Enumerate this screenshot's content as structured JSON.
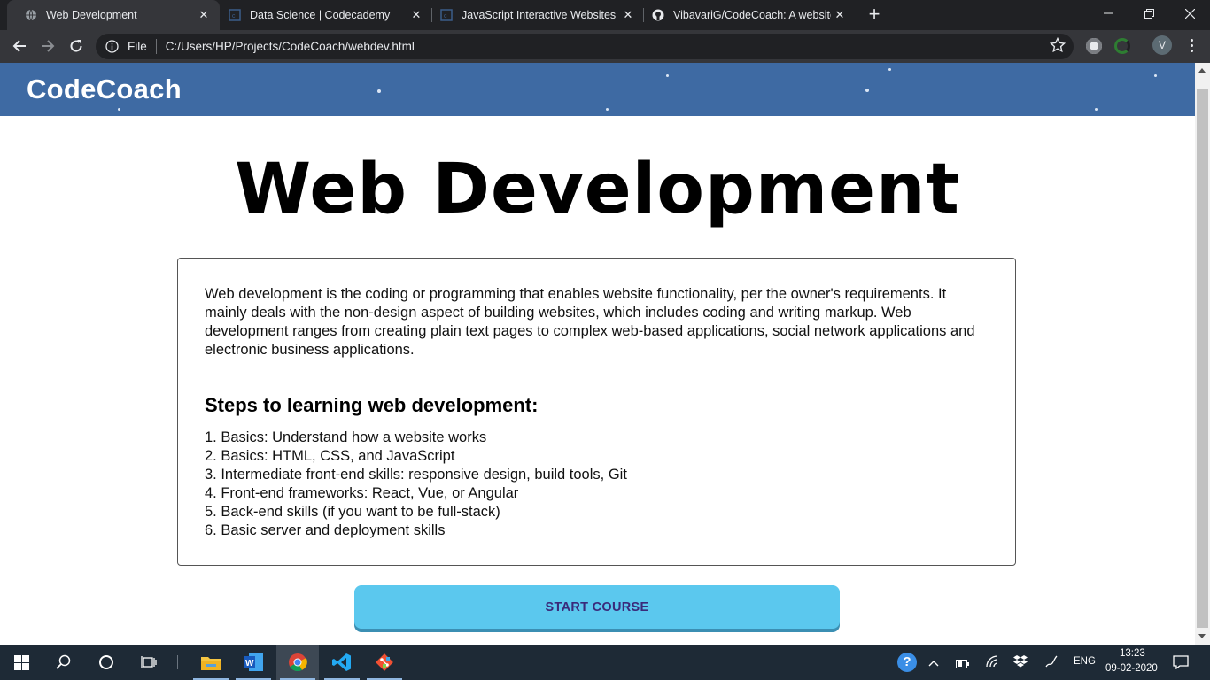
{
  "browser": {
    "tabs": [
      {
        "label": "Web Development",
        "icon": "globe-icon",
        "active": true
      },
      {
        "label": "Data Science | Codecademy",
        "icon": "codecademy-icon",
        "active": false
      },
      {
        "label": "JavaScript Interactive Websites | C",
        "icon": "codecademy-icon",
        "active": false
      },
      {
        "label": "VibavariG/CodeCoach: A website",
        "icon": "github-icon",
        "active": false
      }
    ],
    "new_tab": "+",
    "address": {
      "scheme_label": "File",
      "url": "C:/Users/HP/Projects/CodeCoach/webdev.html"
    },
    "profile_initial": "V"
  },
  "site": {
    "brand": "CodeCoach",
    "title": "Web Development",
    "intro": "Web development is the coding or programming that enables website functionality, per the owner's requirements. It mainly deals with the non-design aspect of building websites, which includes coding and writing markup. Web development ranges from creating plain text pages to complex web-based applications, social network applications and electronic business applications.",
    "steps_heading": "Steps to learning web development:",
    "steps": [
      "1. Basics: Understand how a website works",
      "2. Basics: HTML, CSS, and JavaScript",
      "3. Intermediate front-end skills: responsive design, build tools, Git",
      "4. Front-end frameworks: React, Vue, or Angular",
      "5. Back-end skills (if you want to be full-stack)",
      "6. Basic server and deployment skills"
    ],
    "start_button": "START COURSE",
    "colors": {
      "header": "#3e6aa3",
      "button": "#5bc8ee",
      "button_text": "#3a2a7a"
    }
  },
  "taskbar": {
    "apps": [
      "windows-start-icon",
      "search-icon",
      "cortana-icon",
      "task-view-icon",
      "file-explorer-icon",
      "word-icon",
      "chrome-icon",
      "vscode-icon",
      "git-icon"
    ],
    "language": "ENG",
    "time": "13:23",
    "date": "09-02-2020"
  }
}
